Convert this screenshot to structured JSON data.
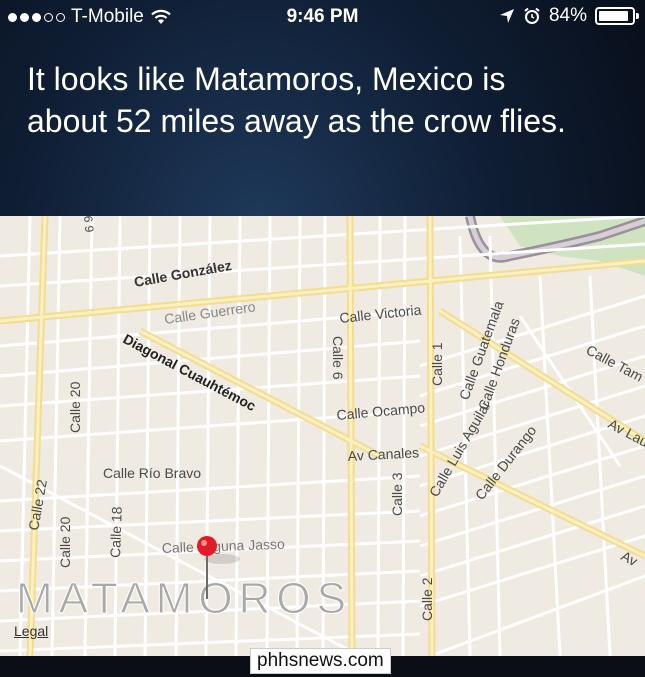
{
  "status_bar": {
    "carrier": "T-Mobile",
    "time": "9:46 PM",
    "battery": "84%",
    "signal_bars_filled": 3,
    "signal_bars_total": 5
  },
  "siri": {
    "response": "It looks like Matamoros, Mexico is about 52 miles away as the crow flies."
  },
  "map": {
    "city_label": "MATAMOROS",
    "legal": "Legal",
    "streets": {
      "gonzalez": "Calle González",
      "guerrero": "Calle Guerrero",
      "victoria": "Calle Victoria",
      "diagonal": "Diagonal Cuauhtémoc",
      "ocampo": "Calle Ocampo",
      "canales": "Av Canales",
      "rio_bravo": "Calle Río Bravo",
      "laguna": "Calle Laguna Jasso",
      "calle6": "Calle 6",
      "calle1": "Calle 1",
      "calle3": "Calle 3",
      "calle2": "Calle 2",
      "calle20a": "Calle 20",
      "calle20b": "Calle 20",
      "calle22": "Calle 22",
      "calle18": "Calle 18",
      "guatemala": "Calle Guatemala",
      "honduras": "Calle Honduras",
      "luis_aguilar": "Calle Luis Aguilar",
      "durango": "Calle Durango",
      "tam": "Calle Tam",
      "av_lau": "Av Lau",
      "av": "Av",
      "num69": "6 9"
    }
  },
  "watermark": "phhsnews.com"
}
